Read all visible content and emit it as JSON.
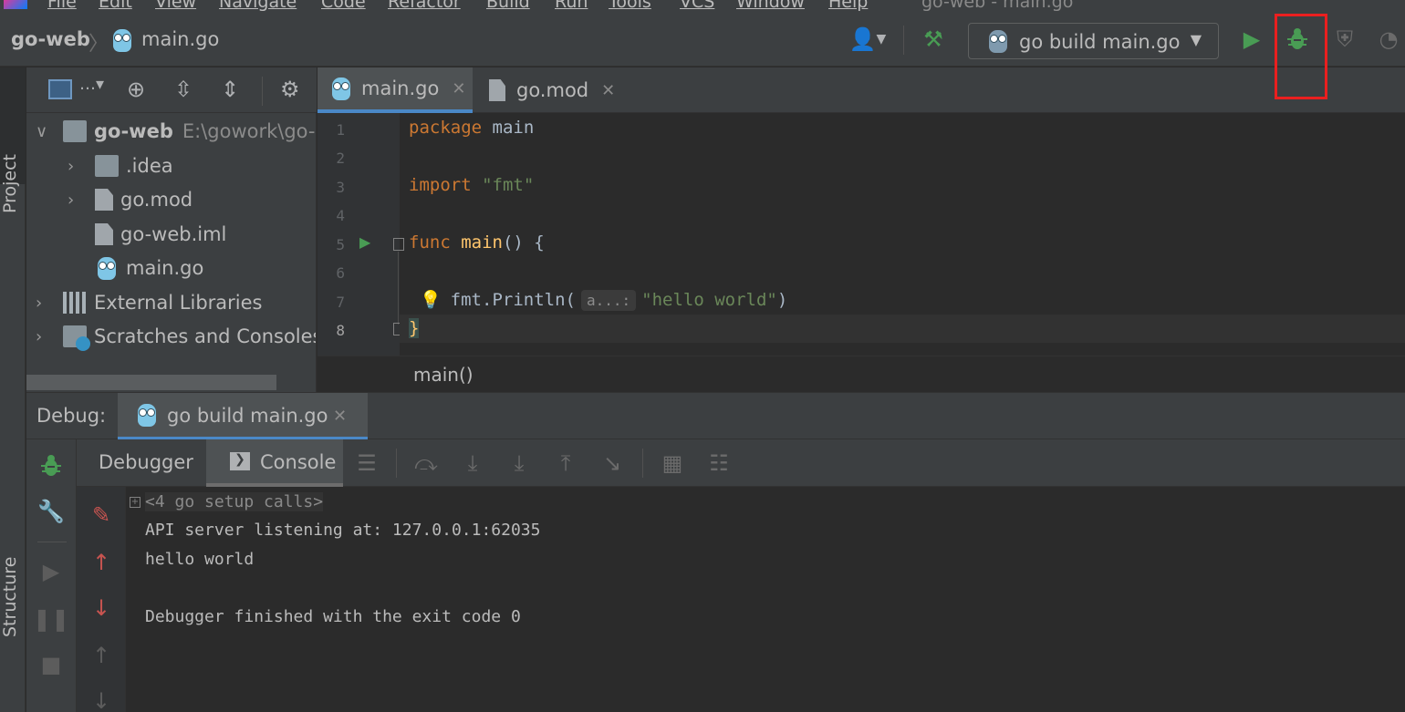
{
  "menu": [
    "File",
    "Edit",
    "View",
    "Navigate",
    "Code",
    "Refactor",
    "Build",
    "Run",
    "Tools",
    "VCS",
    "Window",
    "Help"
  ],
  "window_title": "go-web - main.go",
  "navbar": {
    "project": "go-web",
    "file": "main.go",
    "run_config": "go build main.go"
  },
  "project_panel": {
    "stripe_label": "Project",
    "root": {
      "name": "go-web",
      "path": "E:\\gowork\\go-"
    },
    "items": [
      {
        "label": ".idea",
        "icon": "folder-icon"
      },
      {
        "label": "go.mod",
        "icon": "file-icon"
      },
      {
        "label": "go-web.iml",
        "icon": "file-icon"
      },
      {
        "label": "main.go",
        "icon": "gopher-icon"
      },
      {
        "label": "External Libraries",
        "icon": "libraries-icon"
      },
      {
        "label": "Scratches and Consoles",
        "icon": "scratches-icon"
      }
    ]
  },
  "editor": {
    "tabs": [
      {
        "label": "main.go",
        "active": true
      },
      {
        "label": "go.mod",
        "active": false
      }
    ],
    "line_numbers": [
      "1",
      "2",
      "3",
      "4",
      "5",
      "6",
      "7",
      "8"
    ],
    "code": {
      "l1_kw": "package",
      "l1_name": "main",
      "l3_kw": "import",
      "l3_str": "\"fmt\"",
      "l5_kw": "func",
      "l5_fn": "main",
      "l5_rest": "() {",
      "l7_pkg": "fmt",
      "l7_fn": "Println(",
      "l7_hint": "a...:",
      "l7_str": "\"hello world\"",
      "l7_close": ")",
      "l8": "}"
    },
    "breadcrumb": "main()"
  },
  "debug": {
    "label": "Debug:",
    "session_tab": "go build main.go",
    "tabs": {
      "debugger": "Debugger",
      "console": "Console"
    },
    "stripe_label": "Structure",
    "console_lines": [
      "<4 go setup calls>",
      "API server listening at: 127.0.0.1:62035",
      "hello world",
      "",
      "Debugger finished with the exit code 0"
    ]
  },
  "colors": {
    "accent_blue": "#4a88c7",
    "run_green": "#499c54",
    "highlight_red": "#ea1f1f"
  }
}
